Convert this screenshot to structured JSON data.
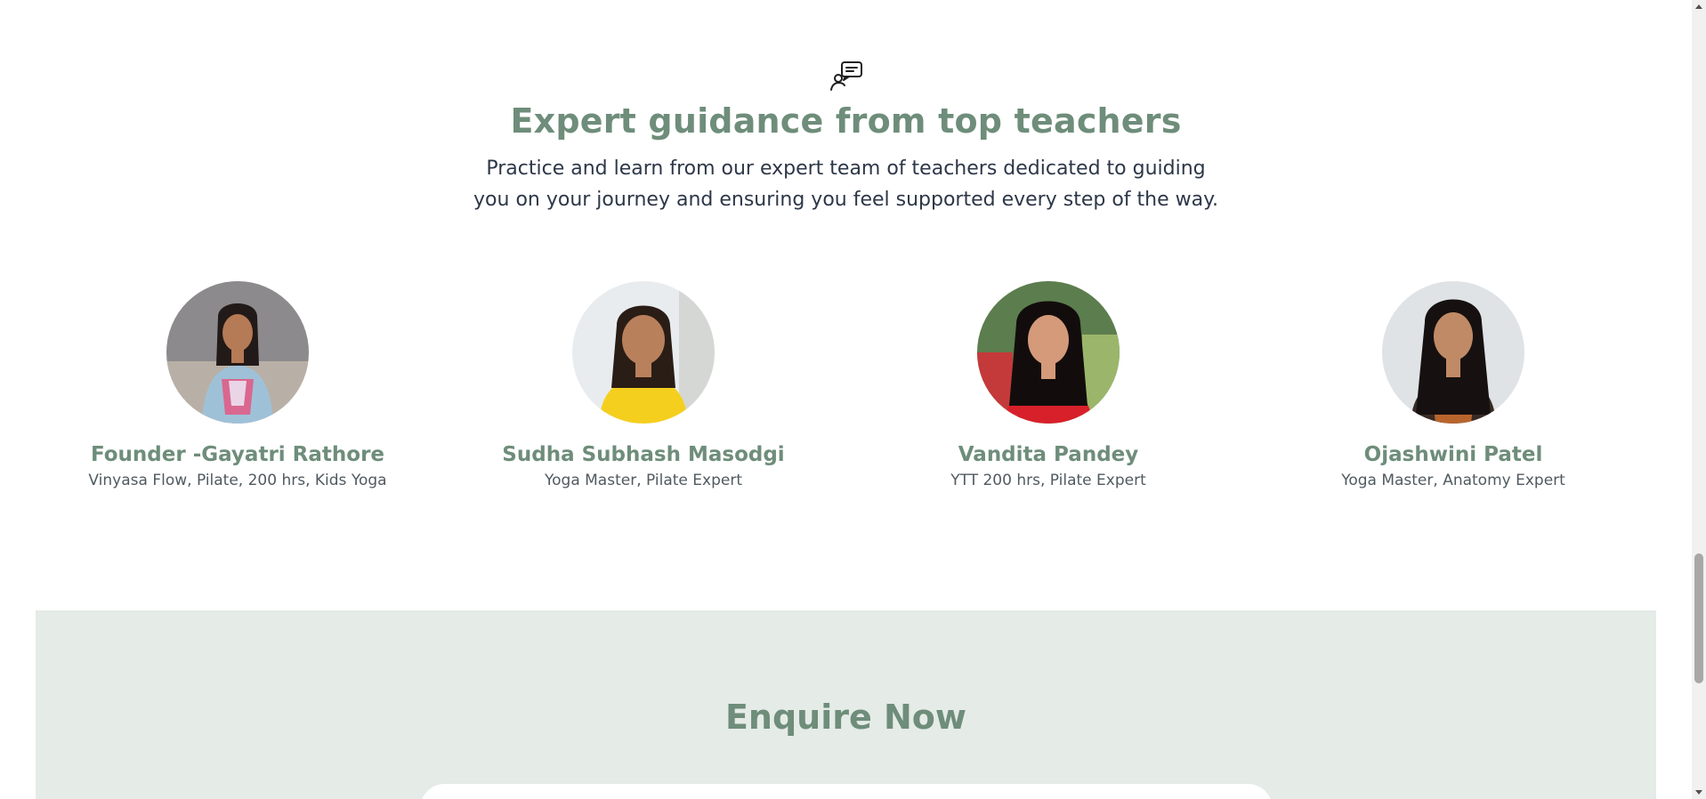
{
  "section": {
    "icon": "chat-person-icon",
    "title": "Expert guidance from top teachers",
    "subtitle": "Practice and learn from our expert team of teachers dedicated to guiding you on your journey and ensuring you feel supported every step of the way."
  },
  "teachers": [
    {
      "name": "Founder -Gayatri Rathore",
      "role": "Vinyasa Flow, Pilate, 200 hrs, Kids Yoga",
      "photo": "gayatri-photo"
    },
    {
      "name": "Sudha Subhash Masodgi",
      "role": "Yoga Master, Pilate Expert",
      "photo": "sudha-photo"
    },
    {
      "name": "Vandita Pandey",
      "role": "YTT 200 hrs, Pilate Expert",
      "photo": "vandita-photo"
    },
    {
      "name": "Ojashwini Patel",
      "role": "Yoga Master, Anatomy Expert",
      "photo": "ojashwini-photo"
    }
  ],
  "enquire": {
    "title": "Enquire Now"
  },
  "colors": {
    "accent": "#6e8d7a",
    "panel": "#e5ebe7",
    "text": "#2d3748"
  }
}
